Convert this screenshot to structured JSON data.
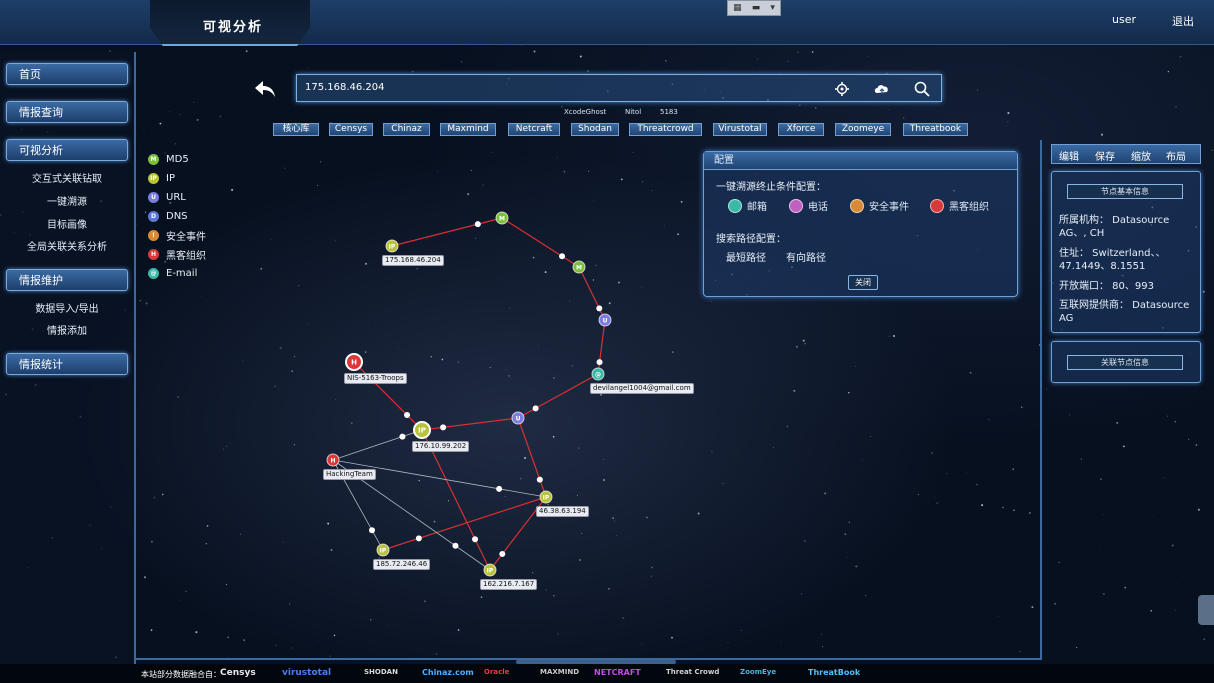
{
  "header": {
    "title": "可视分析",
    "user": "user",
    "logout": "退出"
  },
  "sidebar": {
    "sections": [
      {
        "label": "首页",
        "items": []
      },
      {
        "label": "情报查询",
        "items": []
      },
      {
        "label": "可视分析",
        "items": [
          "交互式关联钻取",
          "一键溯源",
          "目标画像",
          "全局关联关系分析"
        ]
      },
      {
        "label": "情报维护",
        "items": [
          "数据导入/导出",
          "情报添加"
        ]
      },
      {
        "label": "情报统计",
        "items": []
      }
    ]
  },
  "search": {
    "value": "175.168.46.204",
    "tags": [
      "XcodeGhost",
      "Nitol",
      "5183"
    ]
  },
  "source_tabs": [
    "核心库",
    "Censys",
    "Chinaz",
    "Maxmind",
    "Netcraft",
    "Shodan",
    "Threatcrowd",
    "Virustotal",
    "Xforce",
    "Zoomeye",
    "Threatbook"
  ],
  "legend": [
    {
      "label": "MD5",
      "color": "#7bbf3a",
      "glyph": "M"
    },
    {
      "label": "IP",
      "color": "#b8c23a",
      "glyph": "IP"
    },
    {
      "label": "URL",
      "color": "#7b7be0",
      "glyph": "U"
    },
    {
      "label": "DNS",
      "color": "#5a78d8",
      "glyph": "D"
    },
    {
      "label": "安全事件",
      "color": "#d88a36",
      "glyph": "!"
    },
    {
      "label": "黑客组织",
      "color": "#d83a3a",
      "glyph": "H"
    },
    {
      "label": "E-mail",
      "color": "#3ab8a8",
      "glyph": "@"
    }
  ],
  "config": {
    "title": "配置",
    "stop_label": "一键溯源终止条件配置：",
    "stop_options": [
      {
        "label": "邮箱",
        "color": "#3ab8a8"
      },
      {
        "label": "电话",
        "color": "#c060c0"
      },
      {
        "label": "安全事件",
        "color": "#d88a36"
      },
      {
        "label": "黑客组织",
        "color": "#d83a3a"
      }
    ],
    "path_label": "搜索路径配置：",
    "path_options": [
      "最短路径",
      "有向路径"
    ],
    "close": "关闭"
  },
  "right_panel": {
    "tabs": [
      "编辑",
      "保存",
      "缩放",
      "布局"
    ],
    "basic_info_button": "节点基本信息",
    "info": [
      "所属机构： Datasource AG、, CH",
      "住址： Switzerland、、47.1449、8.1551",
      "开放端口： 80、993",
      "互联网提供商： Datasource AG"
    ],
    "related_button": "关联节点信息"
  },
  "graph": {
    "nodes": [
      {
        "id": "ip1",
        "type": "IP",
        "label": "175.168.46.204"
      },
      {
        "id": "md5a",
        "type": "MD5",
        "label": ""
      },
      {
        "id": "md5b",
        "type": "MD5",
        "label": ""
      },
      {
        "id": "url1",
        "type": "URL",
        "label": ""
      },
      {
        "id": "mail",
        "type": "E-mail",
        "label": "devilangel1004@gmail.com"
      },
      {
        "id": "url2",
        "type": "URL",
        "label": ""
      },
      {
        "id": "hack1",
        "type": "黑客组织",
        "label": "NIS-5163-Troops"
      },
      {
        "id": "ip2",
        "type": "IP",
        "label": "176.10.99.202"
      },
      {
        "id": "hack2",
        "type": "黑客组织",
        "label": "HackingTeam"
      },
      {
        "id": "ip3",
        "type": "IP",
        "label": "46.38.63.194"
      },
      {
        "id": "ip4",
        "type": "IP",
        "label": "185.72.246.46"
      },
      {
        "id": "ip5",
        "type": "IP",
        "label": "162.216.7.167"
      }
    ]
  },
  "footer": {
    "label": "本站部分数据融合自：",
    "logos": [
      {
        "text": "Censys",
        "color": "#e8e8e8"
      },
      {
        "text": "virustotal",
        "color": "#4a7cf0"
      },
      {
        "text": "SHODAN",
        "color": "#d9d9d9"
      },
      {
        "text": "Chinaz.com",
        "color": "#4fb0ff"
      },
      {
        "text": "Oracle",
        "color": "#e04040"
      },
      {
        "text": "MAXMIND",
        "color": "#c9c9c9"
      },
      {
        "text": "NETCRAFT",
        "color": "#c050e0"
      },
      {
        "text": "Threat Crowd",
        "color": "#d0d0d0"
      },
      {
        "text": "ZoomEye",
        "color": "#4fb0d8"
      },
      {
        "text": "ThreatBook",
        "color": "#4fc0ff"
      }
    ]
  }
}
